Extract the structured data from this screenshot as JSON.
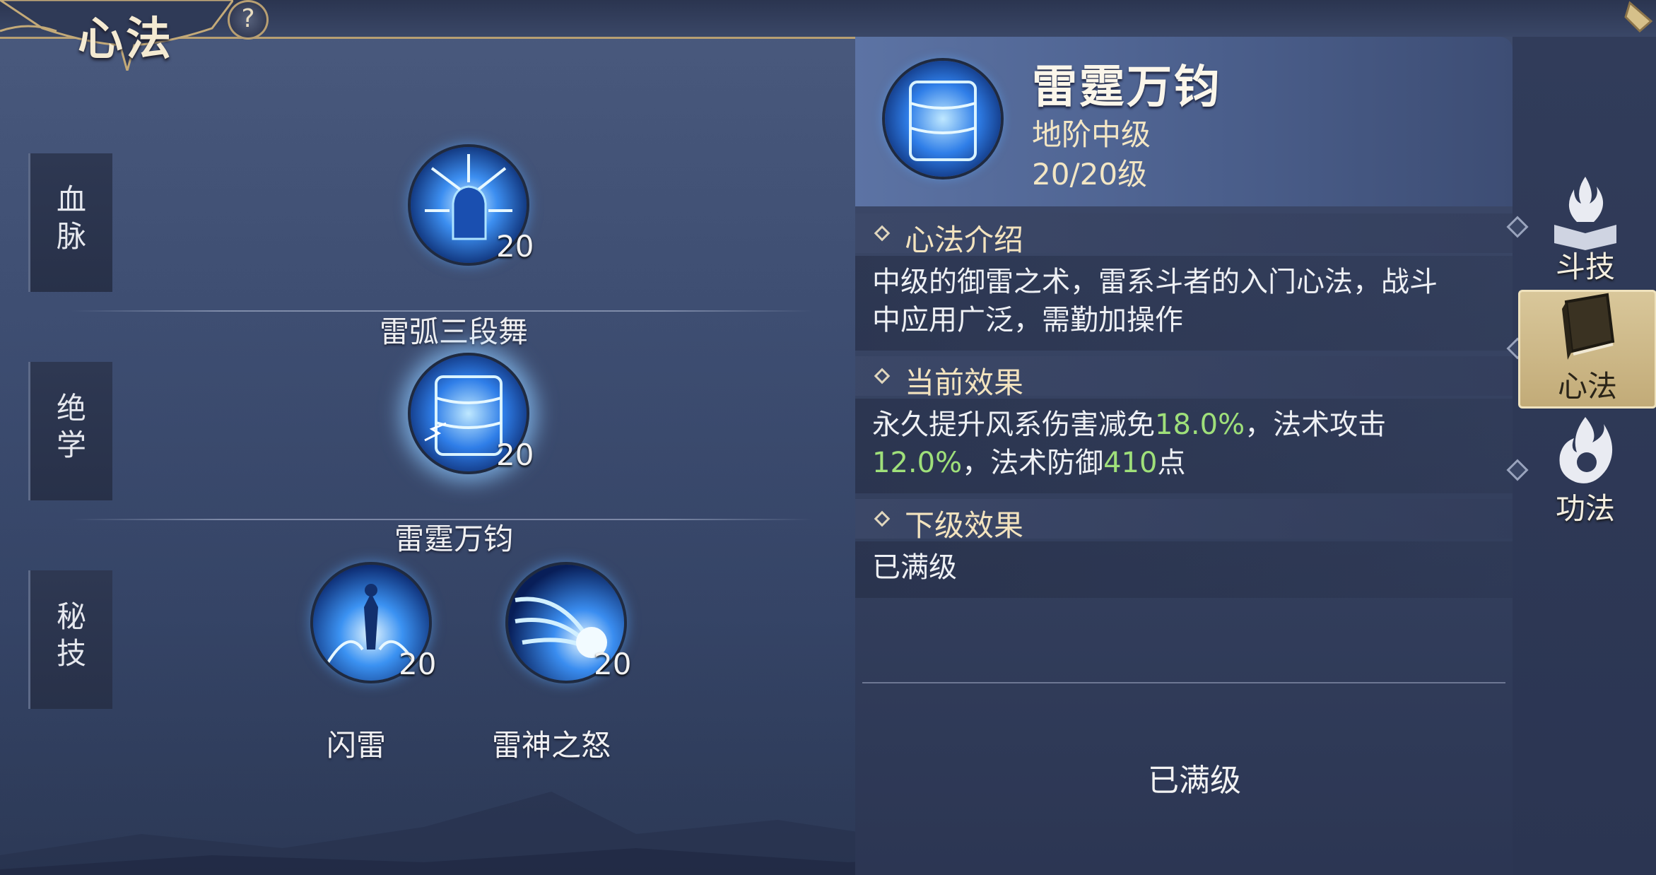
{
  "header": {
    "title": "心法",
    "help_label": "?"
  },
  "rows": [
    {
      "label_chars": [
        "血",
        "脉"
      ],
      "skills": [
        {
          "name": "雷弧三段舞",
          "level": "20"
        }
      ]
    },
    {
      "label_chars": [
        "绝",
        "学"
      ],
      "skills": [
        {
          "name": "雷霆万钧",
          "level": "20"
        }
      ]
    },
    {
      "label_chars": [
        "秘",
        "技"
      ],
      "skills": [
        {
          "name": "闪雷",
          "level": "20"
        },
        {
          "name": "雷神之怒",
          "level": "20"
        }
      ]
    }
  ],
  "detail": {
    "name": "雷霆万钧",
    "grade": "地阶中级",
    "level": "20/20级",
    "intro_title": "心法介绍",
    "intro_line1": "中级的御雷之术，雷系斗者的入门心法，战斗",
    "intro_line2": "中应用广泛，需勤加操作",
    "current_title": "当前效果",
    "current_p1": "永久提升风系伤害减免",
    "current_v1": "18.0%",
    "current_p2": "，法术攻击",
    "current_v2": "12.0%",
    "current_p3": "，法术防御",
    "current_v3": "410",
    "current_p4": "点",
    "next_title": "下级效果",
    "next_text": "已满级",
    "status": "已满级"
  },
  "tabs": [
    {
      "label": "斗技",
      "icon": "flame-book-icon",
      "active": false
    },
    {
      "label": "心法",
      "icon": "book-icon",
      "active": true
    },
    {
      "label": "功法",
      "icon": "flame-swirl-icon",
      "active": false
    }
  ],
  "colors": {
    "highlight_value": "#9fe07a",
    "gold_text": "#f3e3be",
    "active_tab": "#d9c79a"
  }
}
